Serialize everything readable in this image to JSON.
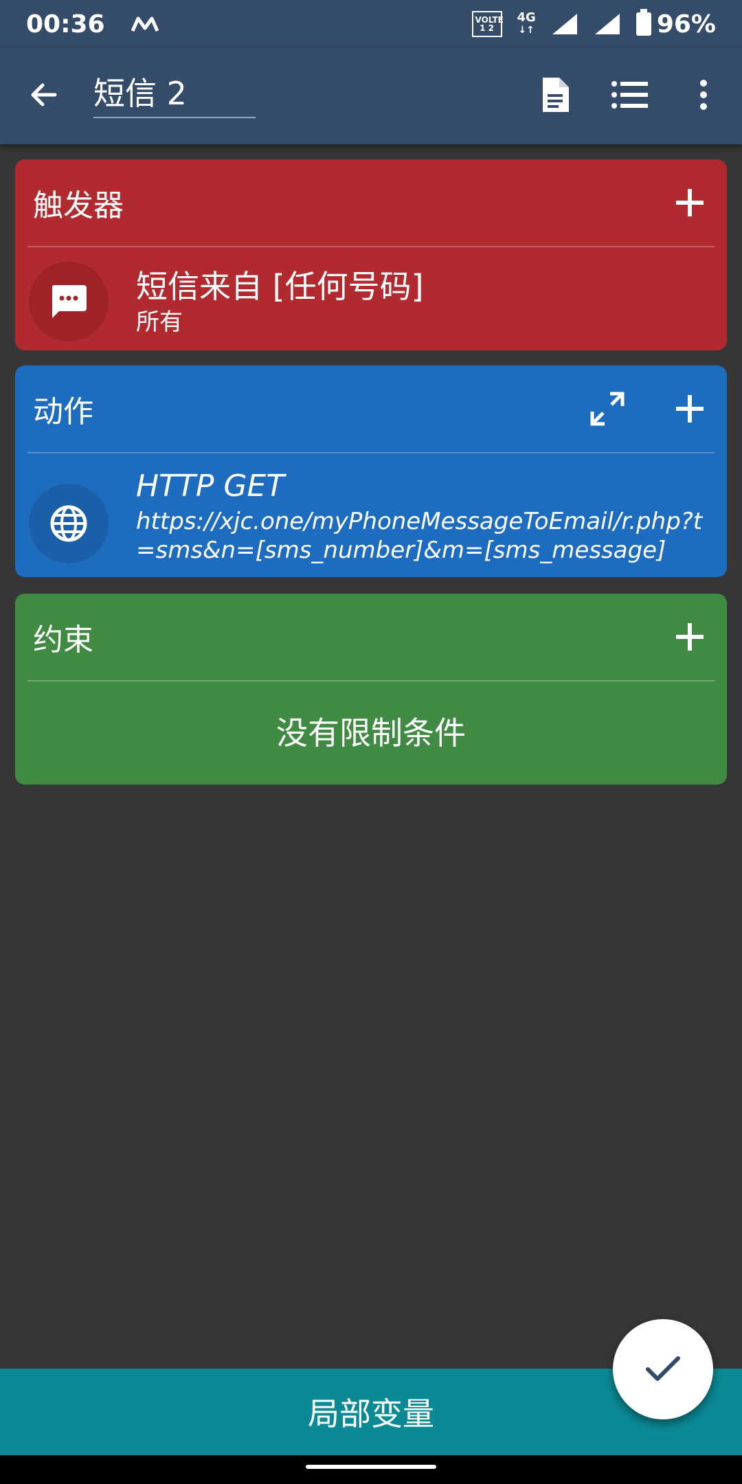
{
  "status_bar": {
    "time": "00:36",
    "carrier_icon": "m-logo-icon",
    "volte_top": "VOLTE",
    "volte_bottom": "1 2",
    "network": "4G",
    "battery": "96%"
  },
  "app_bar": {
    "title": "短信 2",
    "icons": [
      "back-arrow-icon",
      "document-icon",
      "list-icon",
      "more-vert-icon"
    ]
  },
  "trigger_card": {
    "header": "触发器",
    "color": "#b02a2f",
    "item": {
      "icon": "sms-icon",
      "title": "短信来自 [任何号码]",
      "subtitle": "所有"
    }
  },
  "action_card": {
    "header": "动作",
    "color": "#1e6cbf",
    "item": {
      "icon": "globe-icon",
      "title": "HTTP GET",
      "subtitle": "https://xjc.one/myPhoneMessageToEmail/r.php?t=sms&n=[sms_number]&m=[sms_message]"
    }
  },
  "constraint_card": {
    "header": "约束",
    "color": "#418a44",
    "empty_text": "没有限制条件"
  },
  "bottom_bar": {
    "label": "局部变量",
    "color": "#0b8a95"
  },
  "fab": {
    "icon": "check-icon"
  }
}
